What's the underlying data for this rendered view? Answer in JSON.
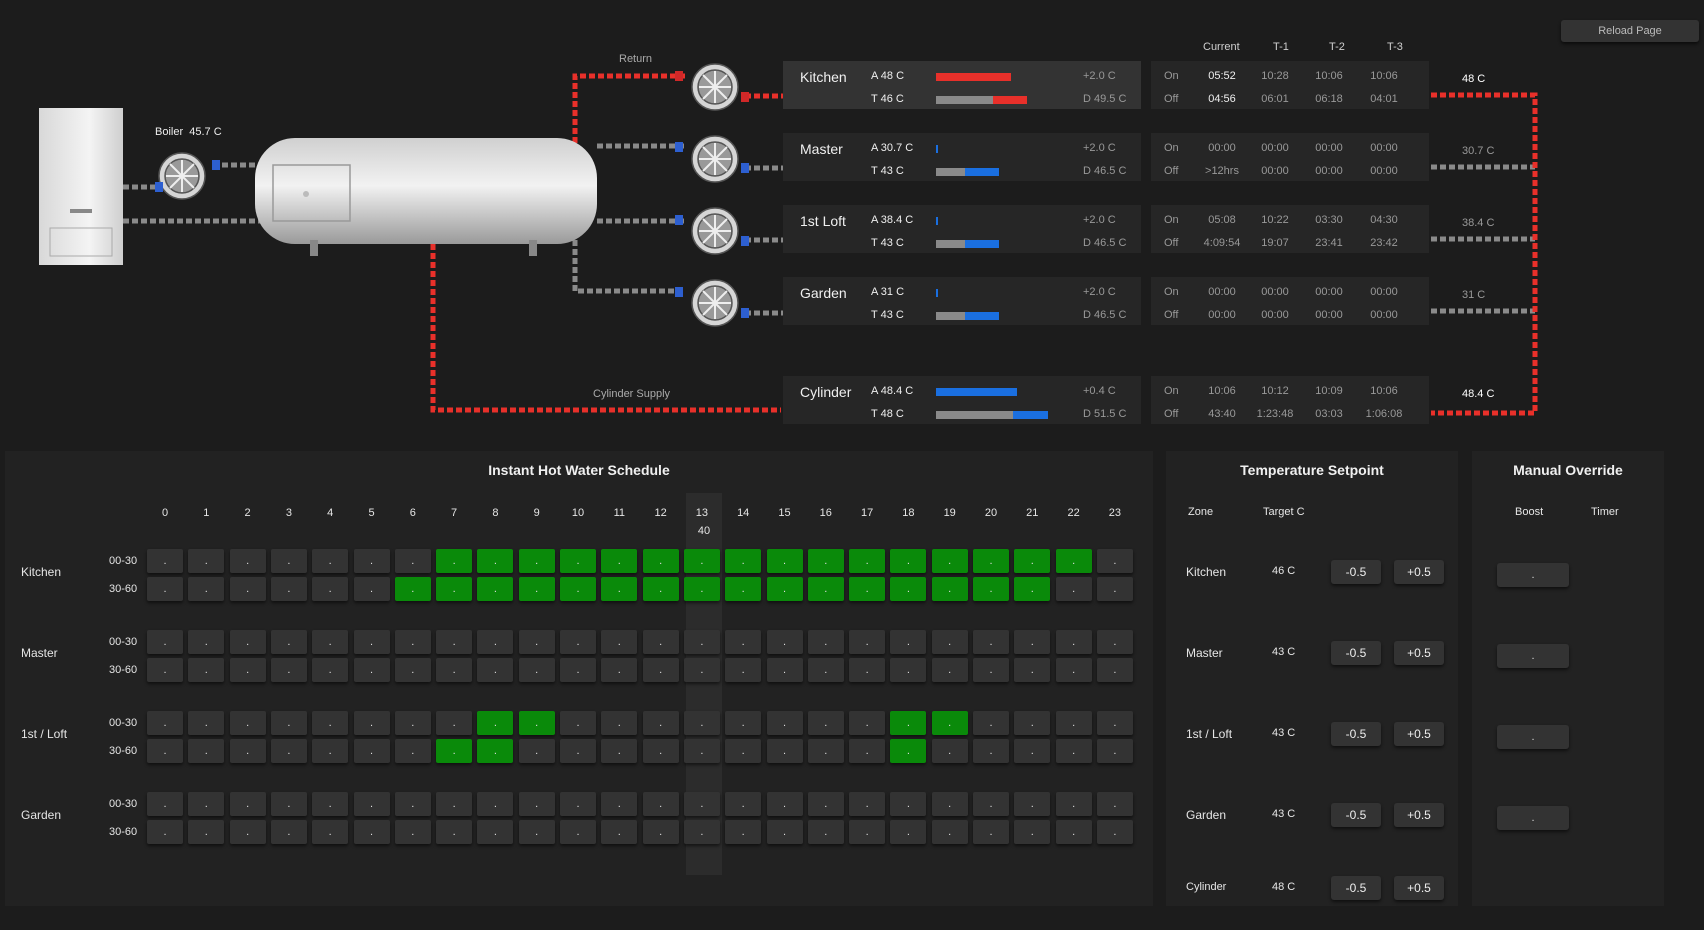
{
  "toolbar": {
    "reload_label": "Reload Page"
  },
  "diagram": {
    "boiler_label": "Boiler",
    "boiler_temp": "45.7 C",
    "return_label": "Return",
    "cylinder_supply_label": "Cylinder Supply"
  },
  "timer_headers": {
    "current": "Current",
    "t1": "T-1",
    "t2": "T-2",
    "t3": "T-3"
  },
  "zones": [
    {
      "name": "Kitchen",
      "actual": "A 48 C",
      "target": "T 46 C",
      "delta": "+2.0 C",
      "demand": "D 49.5 C",
      "actual_level": 0.58,
      "target_level": 0.44,
      "target_excess": 0.26,
      "actual_color": "#e8302a",
      "excess_color": "#e8302a",
      "on_label": "On",
      "off_label": "Off",
      "on_times": [
        "05:52",
        "10:28",
        "10:06",
        "10:06"
      ],
      "off_times": [
        "04:56",
        "06:01",
        "06:18",
        "04:01"
      ],
      "output": "48 C"
    },
    {
      "name": "Master",
      "actual": "A 30.7 C",
      "target": "T 43 C",
      "delta": "+2.0 C",
      "demand": "D 46.5 C",
      "actual_level": 0.01,
      "target_level": 0.22,
      "target_excess": 0.26,
      "actual_color": "#1a6fe0",
      "excess_color": "#1a6fe0",
      "on_label": "On",
      "off_label": "Off",
      "on_times": [
        "00:00",
        "00:00",
        "00:00",
        "00:00"
      ],
      "off_times": [
        ">12hrs",
        "00:00",
        "00:00",
        "00:00"
      ],
      "output": "30.7 C"
    },
    {
      "name": "1st Loft",
      "actual": "A 38.4 C",
      "target": "T 43 C",
      "delta": "+2.0 C",
      "demand": "D 46.5 C",
      "actual_level": 0.01,
      "target_level": 0.22,
      "target_excess": 0.26,
      "actual_color": "#1a6fe0",
      "excess_color": "#1a6fe0",
      "on_label": "On",
      "off_label": "Off",
      "on_times": [
        "05:08",
        "10:22",
        "03:30",
        "04:30"
      ],
      "off_times": [
        "4:09:54",
        "19:07",
        "23:41",
        "23:42"
      ],
      "output": "38.4 C"
    },
    {
      "name": "Garden",
      "actual": "A 31 C",
      "target": "T 43 C",
      "delta": "+2.0 C",
      "demand": "D 46.5 C",
      "actual_level": 0.01,
      "target_level": 0.22,
      "target_excess": 0.26,
      "actual_color": "#1a6fe0",
      "excess_color": "#1a6fe0",
      "on_label": "On",
      "off_label": "Off",
      "on_times": [
        "00:00",
        "00:00",
        "00:00",
        "00:00"
      ],
      "off_times": [
        "00:00",
        "00:00",
        "00:00",
        "00:00"
      ],
      "output": "31 C"
    },
    {
      "name": "Cylinder",
      "actual": "A 48.4 C",
      "target": "T 48 C",
      "delta": "+0.4 C",
      "demand": "D 51.5 C",
      "actual_level": 0.62,
      "target_level": 0.59,
      "target_excess": 0.27,
      "actual_color": "#1a6fe0",
      "excess_color": "#1a6fe0",
      "on_label": "On",
      "off_label": "Off",
      "on_times": [
        "10:06",
        "10:12",
        "10:09",
        "10:06"
      ],
      "off_times": [
        "43:40",
        "1:23:48",
        "03:03",
        "1:06:08"
      ],
      "output": "48.4 C"
    }
  ],
  "schedule": {
    "title": "Instant Hot Water Schedule",
    "hours": [
      "0",
      "1",
      "2",
      "3",
      "4",
      "5",
      "6",
      "7",
      "8",
      "9",
      "10",
      "11",
      "12",
      "13",
      "14",
      "15",
      "16",
      "17",
      "18",
      "19",
      "20",
      "21",
      "22",
      "23"
    ],
    "current_hour_index": 13,
    "current_minute": "40",
    "slot_labels": [
      "00-30",
      "30-60"
    ],
    "cell_label": ".",
    "zones": [
      {
        "name": "Kitchen",
        "first_half": [
          0,
          0,
          0,
          0,
          0,
          0,
          0,
          1,
          1,
          1,
          1,
          1,
          1,
          1,
          1,
          1,
          1,
          1,
          1,
          1,
          1,
          1,
          1,
          0
        ],
        "second_half": [
          0,
          0,
          0,
          0,
          0,
          0,
          1,
          1,
          1,
          1,
          1,
          1,
          1,
          1,
          1,
          1,
          1,
          1,
          1,
          1,
          1,
          1,
          0,
          0
        ]
      },
      {
        "name": "Master",
        "first_half": [
          0,
          0,
          0,
          0,
          0,
          0,
          0,
          0,
          0,
          0,
          0,
          0,
          0,
          0,
          0,
          0,
          0,
          0,
          0,
          0,
          0,
          0,
          0,
          0
        ],
        "second_half": [
          0,
          0,
          0,
          0,
          0,
          0,
          0,
          0,
          0,
          0,
          0,
          0,
          0,
          0,
          0,
          0,
          0,
          0,
          0,
          0,
          0,
          0,
          0,
          0
        ]
      },
      {
        "name": "1st / Loft",
        "first_half": [
          0,
          0,
          0,
          0,
          0,
          0,
          0,
          0,
          1,
          1,
          0,
          0,
          0,
          0,
          0,
          0,
          0,
          0,
          1,
          1,
          0,
          0,
          0,
          0
        ],
        "second_half": [
          0,
          0,
          0,
          0,
          0,
          0,
          0,
          1,
          1,
          0,
          0,
          0,
          0,
          0,
          0,
          0,
          0,
          0,
          1,
          0,
          0,
          0,
          0,
          0
        ]
      },
      {
        "name": "Garden",
        "first_half": [
          0,
          0,
          0,
          0,
          0,
          0,
          0,
          0,
          0,
          0,
          0,
          0,
          0,
          0,
          0,
          0,
          0,
          0,
          0,
          0,
          0,
          0,
          0,
          0
        ],
        "second_half": [
          0,
          0,
          0,
          0,
          0,
          0,
          0,
          0,
          0,
          0,
          0,
          0,
          0,
          0,
          0,
          0,
          0,
          0,
          0,
          0,
          0,
          0,
          0,
          0
        ]
      }
    ]
  },
  "setpoint": {
    "title": "Temperature Setpoint",
    "zone_header": "Zone",
    "target_header": "Target C",
    "minus_label": "-0.5",
    "plus_label": "+0.5",
    "rows": [
      {
        "zone": "Kitchen",
        "target": "46 C"
      },
      {
        "zone": "Master",
        "target": "43 C"
      },
      {
        "zone": "1st / Loft",
        "target": "43 C"
      },
      {
        "zone": "Garden",
        "target": "43 C"
      },
      {
        "zone": "Cylinder",
        "target": "48 C"
      }
    ]
  },
  "override": {
    "title": "Manual Override",
    "boost_header": "Boost",
    "timer_header": "Timer",
    "boost_label": "."
  },
  "colors": {
    "hot_pipe": "#e8302a",
    "cold_pipe": "#8a8a8a",
    "schedule_on": "#0a8a0a",
    "cold_bar": "#1a6fe0"
  }
}
